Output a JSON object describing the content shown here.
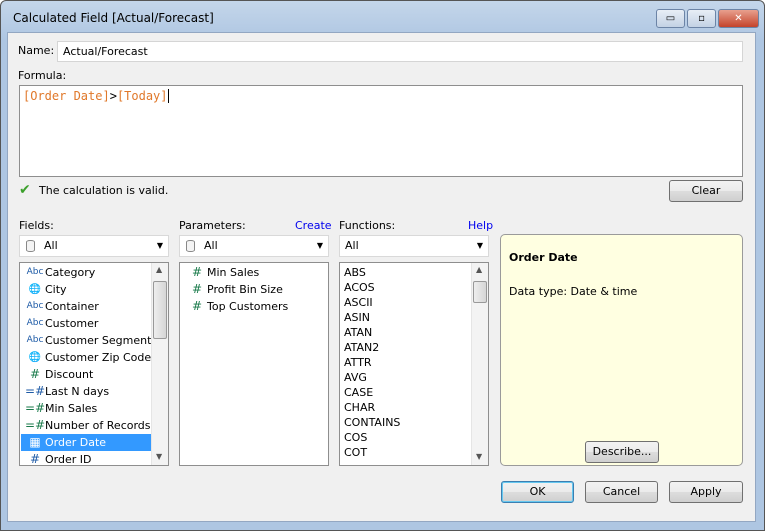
{
  "window": {
    "title": "Calculated Field [Actual/Forecast]",
    "minimize": "▭",
    "maximize": "▫",
    "close": "✕"
  },
  "name": {
    "label": "Name:",
    "value": "Actual/Forecast"
  },
  "formula": {
    "label": "Formula:",
    "field1": "[Order Date]",
    "operator": ">",
    "field2": "[Today]",
    "field_color": "#e0782a"
  },
  "status": {
    "text": "The calculation is valid."
  },
  "clear_label": "Clear",
  "fields": {
    "label": "Fields:",
    "filter": "All",
    "items": [
      {
        "icon": "Abc",
        "label": "Category"
      },
      {
        "icon": "globe",
        "label": "City"
      },
      {
        "icon": "Abc",
        "label": "Container"
      },
      {
        "icon": "Abc",
        "label": "Customer"
      },
      {
        "icon": "Abc",
        "label": "Customer Segment"
      },
      {
        "icon": "globe",
        "label": "Customer Zip Code"
      },
      {
        "icon": "#",
        "label": "Discount"
      },
      {
        "icon": "=#",
        "label": "Last N days"
      },
      {
        "icon": "=#",
        "label": "Min Sales"
      },
      {
        "icon": "=#",
        "label": "Number of Records"
      },
      {
        "icon": "date",
        "label": "Order Date"
      },
      {
        "icon": "#",
        "label": "Order ID"
      }
    ]
  },
  "parameters": {
    "label": "Parameters:",
    "create": "Create",
    "filter": "All",
    "items": [
      "Min Sales",
      "Profit Bin Size",
      "Top Customers"
    ]
  },
  "functions": {
    "label": "Functions:",
    "help": "Help",
    "filter": "All",
    "items": [
      "ABS",
      "ACOS",
      "ASCII",
      "ASIN",
      "ATAN",
      "ATAN2",
      "ATTR",
      "AVG",
      "CASE",
      "CHAR",
      "CONTAINS",
      "COS",
      "COT"
    ]
  },
  "info": {
    "title": "Order Date",
    "detail": "Data type: Date & time",
    "describe": "Describe..."
  },
  "buttons": {
    "ok": "OK",
    "cancel": "Cancel",
    "apply": "Apply"
  }
}
